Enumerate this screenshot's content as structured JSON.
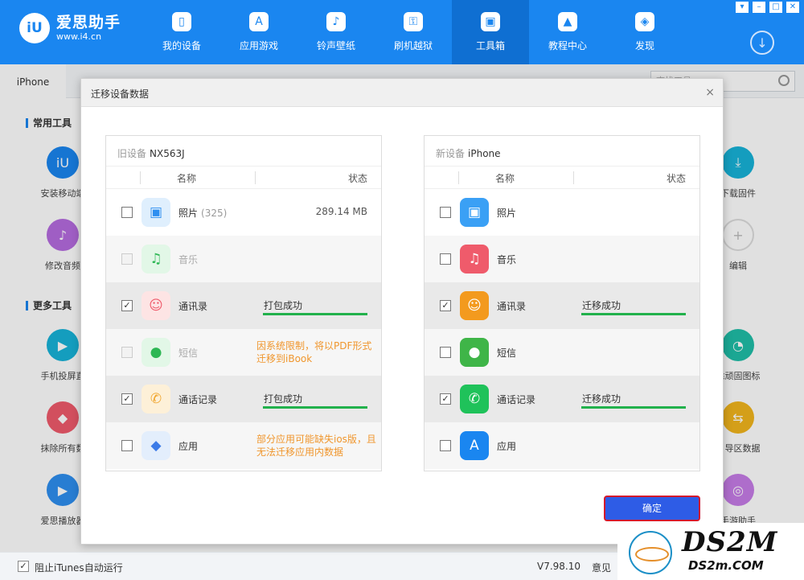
{
  "app": {
    "brand": "爱思助手",
    "brand_url": "www.i4.cn",
    "logo_mark": "iU",
    "window_controls": [
      "▾",
      "–",
      "□",
      "✕"
    ]
  },
  "nav": {
    "items": [
      {
        "label": "我的设备",
        "icon": "phone-icon",
        "glyph": "▯"
      },
      {
        "label": "应用游戏",
        "icon": "app-store-icon",
        "glyph": "A"
      },
      {
        "label": "铃声壁纸",
        "icon": "music-icon",
        "glyph": "♪"
      },
      {
        "label": "刷机越狱",
        "icon": "shield-icon",
        "glyph": "⚿"
      },
      {
        "label": "工具箱",
        "icon": "toolbox-icon",
        "glyph": "▣"
      },
      {
        "label": "教程中心",
        "icon": "graduation-cap-icon",
        "glyph": "▲"
      },
      {
        "label": "发现",
        "icon": "compass-icon",
        "glyph": "◈"
      }
    ],
    "active_index": 4,
    "download_glyph": "↓"
  },
  "background": {
    "tab": "iPhone",
    "search_placeholder": "查找工具",
    "section_common": "常用工具",
    "section_more": "更多工具",
    "left_tools": [
      {
        "label": "安装移动端",
        "color": "#1a86f0",
        "glyph": "iU"
      },
      {
        "label": "修改音频",
        "color": "#b56be0",
        "glyph": "♪"
      },
      {
        "label": "手机投屏直",
        "color": "#17b3d9",
        "glyph": "▶"
      },
      {
        "label": "抹除所有数",
        "color": "#ef5b6b",
        "glyph": "◆"
      },
      {
        "label": "爱思播放器",
        "color": "#2e8ff0",
        "glyph": "▶"
      }
    ],
    "right_tools": [
      {
        "label": "下载固件",
        "color": "#17b3d9",
        "glyph": "⤓"
      },
      {
        "label": "编辑",
        "color": "#e3e3e3",
        "glyph": "+"
      },
      {
        "label": "除顽固图标",
        "color": "#1fbfa8",
        "glyph": "◔"
      },
      {
        "label": "引导区数据",
        "color": "#f2b61d",
        "glyph": "⇆"
      },
      {
        "label": "手游助手",
        "color": "#c77de8",
        "glyph": "◎"
      }
    ],
    "footer": {
      "itunes_check_label": "阻止iTunes自动运行",
      "version": "V7.98.10",
      "feedback": "意见"
    }
  },
  "dialog": {
    "title": "迁移设备数据",
    "close_glyph": "×",
    "ok_label": "确定",
    "old": {
      "prefix": "旧设备",
      "device": "NX563J",
      "col_name": "名称",
      "col_status": "状态",
      "rows": [
        {
          "name": "照片",
          "count": "(325)",
          "size": "289.14 MB",
          "checked": false,
          "disabled": false,
          "icon": "photos-icon",
          "color": "#dfeffd",
          "glyph": "▣",
          "glyph_color": "#2e8ff0"
        },
        {
          "name": "音乐",
          "checked": false,
          "disabled": true,
          "icon": "music-icon",
          "color": "#e2f7e7",
          "glyph": "♫",
          "glyph_color": "#2db754"
        },
        {
          "name": "通讯录",
          "status": "打包成功",
          "checked": true,
          "disabled": false,
          "icon": "contacts-icon",
          "color": "#fde4e4",
          "glyph": "☺",
          "glyph_color": "#ef5b6b"
        },
        {
          "name": "短信",
          "note": "因系统限制，将以PDF形式迁移到iBook",
          "checked": false,
          "disabled": true,
          "icon": "message-icon",
          "color": "#e2f7e7",
          "glyph": "●",
          "glyph_color": "#2db754"
        },
        {
          "name": "通话记录",
          "status": "打包成功",
          "checked": true,
          "disabled": false,
          "icon": "phone-icon",
          "color": "#fdf0d8",
          "glyph": "✆",
          "glyph_color": "#f0a52d"
        },
        {
          "name": "应用",
          "note": "部分应用可能缺失ios版，且无法迁移应用内数据",
          "checked": false,
          "disabled": false,
          "icon": "android-icon",
          "color": "#e3eefc",
          "glyph": "◆",
          "glyph_color": "#3b7be8"
        }
      ]
    },
    "new": {
      "prefix": "新设备",
      "device": "iPhone",
      "col_name": "名称",
      "col_status": "状态",
      "rows": [
        {
          "name": "照片",
          "checked": false,
          "icon": "photos-icon",
          "color": "#3aa0f5",
          "glyph": "▣"
        },
        {
          "name": "音乐",
          "checked": false,
          "icon": "music-icon",
          "color": "#ef5b6b",
          "glyph": "♫"
        },
        {
          "name": "通讯录",
          "status": "迁移成功",
          "checked": true,
          "icon": "contacts-icon",
          "color": "#f39a1e",
          "glyph": "☺"
        },
        {
          "name": "短信",
          "checked": false,
          "icon": "message-icon",
          "color": "#3fb548",
          "glyph": "●"
        },
        {
          "name": "通话记录",
          "status": "迁移成功",
          "checked": true,
          "icon": "phone-icon",
          "color": "#1fc25a",
          "glyph": "✆"
        },
        {
          "name": "应用",
          "checked": false,
          "icon": "app-store-icon",
          "color": "#1a86f0",
          "glyph": "A"
        }
      ]
    }
  },
  "watermark": {
    "text": "DS2M",
    "sub": "DS2m.COM"
  }
}
